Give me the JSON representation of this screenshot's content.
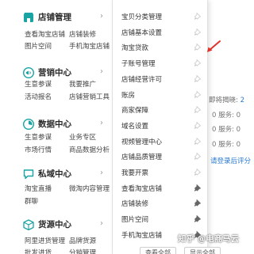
{
  "sections": [
    {
      "key": "shop",
      "title": "店铺管理",
      "icon": "store-icon",
      "links": [
        "查看淘宝店铺",
        "店铺装修",
        "图片空间",
        "手机淘宝店铺"
      ]
    },
    {
      "key": "marketing",
      "title": "营销中心",
      "icon": "megaphone-icon",
      "links": [
        "生意参谋",
        "我要推广",
        "活动报名",
        "店铺营销工具"
      ]
    },
    {
      "key": "data",
      "title": "数据中心",
      "icon": "pie-chart-icon",
      "links": [
        "生意参谋",
        "业务专区",
        "市场行情",
        "商品数据分析"
      ]
    },
    {
      "key": "private",
      "title": "私域中心",
      "icon": "chat-icon",
      "links": [
        "淘宝直播",
        "微淘内容管理",
        "群聊"
      ]
    },
    {
      "key": "supply",
      "title": "货源中心",
      "icon": "box-icon",
      "links": [
        "阿里进货管理",
        "品牌货源",
        "批发进货",
        "分销管理"
      ]
    }
  ],
  "submenu": [
    {
      "label": "宝贝分类管理",
      "pinned": false
    },
    {
      "label": "店铺基本设置",
      "pinned": false
    },
    {
      "label": "淘宝贷款",
      "pinned": false
    },
    {
      "label": "子账号管理",
      "pinned": false
    },
    {
      "label": "店铺经营许可",
      "pinned": false
    },
    {
      "label": "账房",
      "pinned": false
    },
    {
      "label": "商家保障",
      "pinned": false
    },
    {
      "label": "域名设置",
      "pinned": false
    },
    {
      "label": "视频管理中心",
      "pinned": false
    },
    {
      "label": "店铺品质管理",
      "pinned": false
    },
    {
      "label": "我要开票",
      "pinned": false
    },
    {
      "label": "查看淘宝店铺",
      "pinned": true
    },
    {
      "label": "店铺装修",
      "pinned": true
    },
    {
      "label": "图片空间",
      "pinned": true
    },
    {
      "label": "手机淘宝店铺",
      "pinned": true
    }
  ],
  "right_page": {
    "pending_label": "即将揭晓: ",
    "pending_value": "2",
    "service_rows": [
      "0 服务: 0",
      "0 服务: 0",
      "0 服务: 0"
    ],
    "link_text": "请登录后评分",
    "bottom_buttons": [
      "查看全部",
      "显示全部"
    ]
  },
  "watermark": "知乎 @电商马云",
  "colors": {
    "highlight": "#e85412",
    "icon_teal": "#19a3a3",
    "link_blue": "#2a7bd1"
  }
}
